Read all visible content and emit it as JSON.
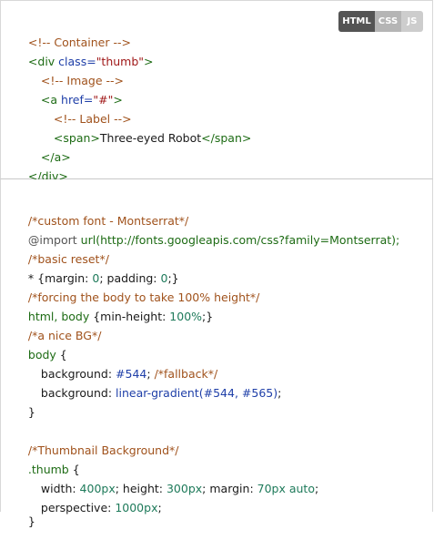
{
  "tabs": {
    "html": "HTML",
    "css": "CSS",
    "js": "JS"
  },
  "html_code": {
    "l1": "<!-- Container -->",
    "l2_open": "<div ",
    "l2_attr": "class=",
    "l2_str": "\"thumb\"",
    "l2_close": ">",
    "l3": "<!-- Image -->",
    "l4_open": "<a ",
    "l4_attr": "href=",
    "l4_str": "\"#\"",
    "l4_close": ">",
    "l5": "<!-- Label -->",
    "l6_open": "<span>",
    "l6_text": "Three-eyed Robot",
    "l6_close": "</span>",
    "l7": "</a>",
    "l8": "</div>"
  },
  "css_code": {
    "c1": "/*custom font - Montserrat*/",
    "c2_kw": "@import ",
    "c2_val": "url(http://fonts.googleapis.com/css?family=Montserrat);",
    "c3": "/*basic reset*/",
    "c4_sel": "* ",
    "c4_body": "{margin: ",
    "c4_v1": "0",
    "c4_mid": "; padding: ",
    "c4_v2": "0",
    "c4_end": ";}",
    "c5": "/*forcing the body to take 100% height*/",
    "c6_sel": "html, body ",
    "c6_body": "{min-height: ",
    "c6_v": "100%",
    "c6_end": ";}",
    "c7": "/*a nice BG*/",
    "c8_sel": "body ",
    "c8_br": "{",
    "c9_prop": "background: ",
    "c9_v": "#544",
    "c9_semi": "; ",
    "c9_cm": "/*fallback*/",
    "c10_prop": "background: ",
    "c10_v": "linear-gradient(#544, #565)",
    "c10_end": ";",
    "c11": "}",
    "c12": "/*Thumbnail Background*/",
    "c13_sel": ".thumb ",
    "c13_br": "{",
    "c14_p1": "width: ",
    "c14_v1": "400px",
    "c14_p2": "; height: ",
    "c14_v2": "300px",
    "c14_p3": "; margin: ",
    "c14_v3": "70px auto",
    "c14_end": ";",
    "c15_p": "perspective: ",
    "c15_v": "1000px",
    "c15_end": ";",
    "c16": "}"
  }
}
